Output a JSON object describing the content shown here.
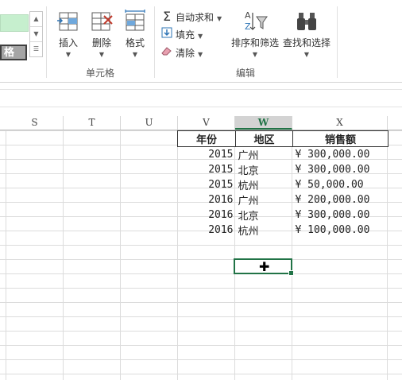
{
  "styles": {
    "check_cell_label": "格"
  },
  "ribbon": {
    "cells_group": {
      "label": "单元格",
      "insert": "插入",
      "delete": "删除",
      "format": "格式"
    },
    "editing_group": {
      "label": "编辑",
      "autosum": "自动求和",
      "fill": "填充",
      "clear": "清除",
      "sort_filter": "排序和筛选",
      "find_select": "查找和选择"
    }
  },
  "columns": [
    "S",
    "T",
    "U",
    "V",
    "W",
    "X"
  ],
  "selected_column": "W",
  "table": {
    "headers": {
      "year": "年份",
      "region": "地区",
      "sales": "销售额"
    },
    "rows": [
      {
        "year": "2015",
        "region": "广州",
        "sales": "¥  300,000.00"
      },
      {
        "year": "2015",
        "region": "北京",
        "sales": "¥  300,000.00"
      },
      {
        "year": "2015",
        "region": "杭州",
        "sales": "¥   50,000.00"
      },
      {
        "year": "2016",
        "region": "广州",
        "sales": "¥  200,000.00"
      },
      {
        "year": "2016",
        "region": "北京",
        "sales": "¥  300,000.00"
      },
      {
        "year": "2016",
        "region": "杭州",
        "sales": "¥  100,000.00"
      }
    ]
  },
  "colors": {
    "accent": "#217346",
    "good_fill": "#c6efce",
    "check_fill": "#a5a5a5"
  }
}
